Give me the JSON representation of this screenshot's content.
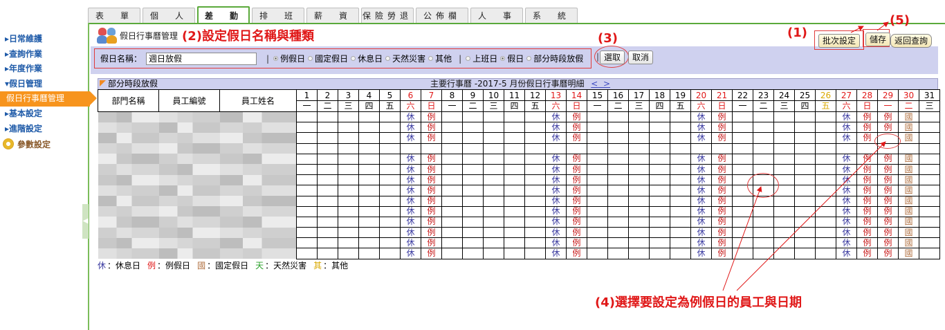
{
  "nav_tabs": [
    "表　單",
    "個　人",
    "差　勤",
    "排　班",
    "薪　資",
    "保險勞退",
    "公佈欄",
    "人　事",
    "系　統"
  ],
  "active_tab": 2,
  "sidebar": {
    "items": [
      {
        "label": "▸日常維護",
        "icon": "triangle-right-icon"
      },
      {
        "label": "▸查詢作業",
        "icon": "triangle-right-icon"
      },
      {
        "label": "▸年度作業",
        "icon": "triangle-right-icon"
      },
      {
        "label": "▾假日管理",
        "icon": "triangle-down-icon"
      },
      {
        "label": "假日行事曆管理",
        "active": true
      },
      {
        "label": "▸基本設定",
        "icon": "triangle-right-icon"
      },
      {
        "label": "▸進階設定",
        "icon": "triangle-right-icon"
      },
      {
        "label": "參數設定",
        "icon": "gear-icon"
      }
    ]
  },
  "page": {
    "title": "假日行事曆管理"
  },
  "annotations": {
    "step1": "(1)",
    "step2": "(2)設定假日名稱與種類",
    "step3": "(3)",
    "step4": "(4)選擇要設定為例假日的員工與日期",
    "step5": "(5)"
  },
  "form": {
    "name_label": "假日名稱：",
    "name_value": "週日放假",
    "type_options": [
      {
        "label": "例假日",
        "selected": true
      },
      {
        "label": "國定假日",
        "selected": false
      },
      {
        "label": "休息日",
        "selected": false
      },
      {
        "label": "天然災害",
        "selected": false
      },
      {
        "label": "其他",
        "selected": false
      }
    ],
    "mode_options": [
      {
        "label": "上班日",
        "selected": false
      },
      {
        "label": "假日",
        "selected": true
      },
      {
        "label": "部分時段放假",
        "selected": false
      }
    ],
    "select_button": "選取",
    "cancel_button": "取消"
  },
  "actions": {
    "batch_set": "批次設定",
    "save": "儲存",
    "back_query": "返回查詢"
  },
  "calendar": {
    "selected_type": "部分時段放假",
    "title": "主要行事曆 -2017-5 月份假日行事曆明細",
    "nav_prev": "<",
    "nav_next": ">",
    "columns": [
      "部門名稱",
      "員工編號",
      "員工姓名"
    ],
    "days": [
      1,
      2,
      3,
      4,
      5,
      6,
      7,
      8,
      9,
      10,
      11,
      12,
      13,
      14,
      15,
      16,
      17,
      18,
      19,
      20,
      21,
      22,
      23,
      24,
      25,
      26,
      27,
      28,
      29,
      30,
      31
    ],
    "weekdays": [
      "一",
      "二",
      "三",
      "四",
      "五",
      "六",
      "日",
      "一",
      "二",
      "三",
      "四",
      "五",
      "六",
      "日",
      "一",
      "二",
      "三",
      "四",
      "五",
      "六",
      "日",
      "一",
      "二",
      "三",
      "四",
      "五",
      "六",
      "日",
      "一",
      "二",
      "三"
    ],
    "day_colors": {
      "6": "red",
      "7": "red",
      "13": "red",
      "14": "red",
      "20": "red",
      "21": "red",
      "26": "yellow",
      "27": "red",
      "28": "red",
      "29": "red",
      "30": "red"
    },
    "rows": [
      {
        "marks": {
          "6": "休",
          "7": "例",
          "13": "休",
          "14": "例",
          "20": "休",
          "21": "例",
          "27": "休",
          "28": "例",
          "29": "例",
          "30": "國"
        }
      },
      {
        "marks": {
          "6": "休",
          "7": "例",
          "13": "休",
          "14": "例",
          "20": "休",
          "21": "例",
          "27": "休",
          "28": "例",
          "29": "例",
          "30": "國"
        }
      },
      {
        "marks": {
          "6": "休",
          "7": "例",
          "13": "休",
          "14": "例",
          "20": "休",
          "21": "例",
          "27": "休",
          "28": "例",
          "29": "",
          "30": "國"
        }
      },
      {
        "marks": {}
      },
      {
        "marks": {
          "6": "休",
          "7": "例",
          "13": "休",
          "14": "例",
          "20": "休",
          "21": "例",
          "27": "休",
          "28": "例",
          "29": "例",
          "30": "國"
        }
      },
      {
        "marks": {
          "6": "休",
          "7": "例",
          "13": "休",
          "14": "例",
          "20": "休",
          "21": "例",
          "27": "休",
          "28": "例",
          "29": "例",
          "30": "國"
        }
      },
      {
        "marks": {
          "6": "休",
          "7": "例",
          "13": "休",
          "14": "例",
          "20": "休",
          "21": "例",
          "27": "休",
          "28": "例",
          "29": "例",
          "30": "國"
        }
      },
      {
        "marks": {
          "6": "休",
          "7": "例",
          "13": "休",
          "14": "例",
          "20": "休",
          "21": "例",
          "27": "休",
          "28": "例",
          "29": "例",
          "30": "國"
        }
      },
      {
        "marks": {
          "6": "休",
          "7": "例",
          "13": "休",
          "14": "例",
          "20": "休",
          "21": "例",
          "27": "休",
          "28": "例",
          "29": "例",
          "30": "國"
        }
      },
      {
        "marks": {
          "6": "休",
          "7": "例",
          "13": "休",
          "14": "例",
          "20": "休",
          "21": "例",
          "27": "休",
          "28": "例",
          "29": "例",
          "30": "國"
        }
      },
      {
        "marks": {
          "6": "休",
          "7": "例",
          "13": "休",
          "14": "例",
          "20": "休",
          "21": "例",
          "27": "休",
          "28": "例",
          "29": "例",
          "30": "國"
        }
      },
      {
        "marks": {
          "6": "休",
          "7": "例",
          "13": "休",
          "14": "例",
          "20": "休",
          "21": "例",
          "27": "休",
          "28": "例",
          "29": "例",
          "30": "國"
        }
      },
      {
        "marks": {
          "6": "休",
          "7": "例",
          "13": "休",
          "14": "例",
          "20": "休",
          "21": "例",
          "27": "休",
          "28": "例",
          "29": "例",
          "30": "國"
        }
      },
      {
        "marks": {
          "6": "休",
          "7": "例",
          "13": "休",
          "14": "例",
          "20": "休",
          "21": "例",
          "27": "休",
          "28": "例",
          "29": "例",
          "30": "國"
        }
      }
    ]
  },
  "legend": [
    {
      "key": "休",
      "text": "：休息日",
      "color": "#3a3aa0"
    },
    {
      "key": "例",
      "text": "：例假日",
      "color": "#e01818"
    },
    {
      "key": "國",
      "text": "：國定假日",
      "color": "#b07040"
    },
    {
      "key": "天",
      "text": "：天然災害",
      "color": "#2aa12a"
    },
    {
      "key": "其",
      "text": "：其他",
      "color": "#d9a800"
    }
  ]
}
